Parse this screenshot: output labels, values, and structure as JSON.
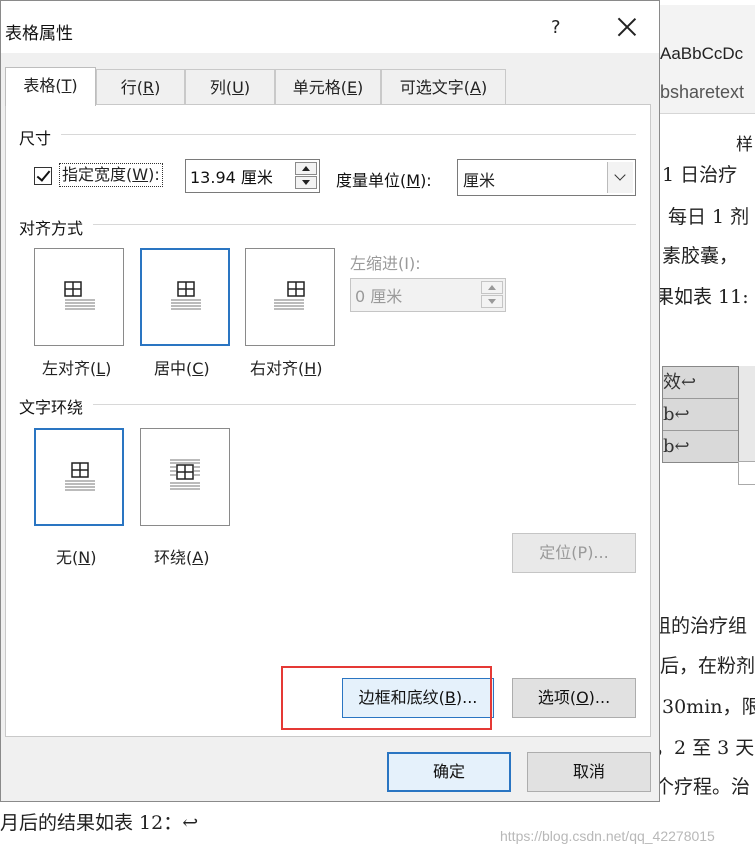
{
  "document": {
    "ribbon_style_preview": "AaBbCcDc",
    "ribbon_style_name": "bsharetext",
    "ribbon_style_label": "样",
    "lines": [
      "1 日治疗",
      "每日 1 剂",
      "素胶囊，",
      "果如表 11:",
      "组的治疗组",
      "后，在粉剂",
      "30min，限",
      "，2 至 3 天",
      "个疗程。治"
    ],
    "table_cells": [
      "效↩",
      "b↩",
      "b↩"
    ],
    "bottom_text": "月后的结果如表 12：↩",
    "watermark": "https://blog.csdn.net/qq_42278015"
  },
  "dialog": {
    "title": "表格属性",
    "help_label": "?",
    "tabs": [
      {
        "label": "表格(",
        "key": "T",
        "tail": ")",
        "active": true
      },
      {
        "label": "行(",
        "key": "R",
        "tail": ")",
        "active": false
      },
      {
        "label": "列(",
        "key": "U",
        "tail": ")",
        "active": false
      },
      {
        "label": "单元格(",
        "key": "E",
        "tail": ")",
        "active": false
      },
      {
        "label": "可选文字(",
        "key": "A",
        "tail": ")",
        "active": false
      }
    ],
    "size_section": {
      "label": "尺寸",
      "checkbox_label_pre": "指定宽度(",
      "checkbox_key": "W",
      "checkbox_label_post": "):",
      "checked": true,
      "width_value": "13.94 厘米",
      "unit_label_pre": "度量单位(",
      "unit_key": "M",
      "unit_label_post": "):",
      "unit_value": "厘米"
    },
    "align_section": {
      "label": "对齐方式",
      "options": [
        {
          "pre": "左对齐(",
          "key": "L",
          "post": ")",
          "selected": false
        },
        {
          "pre": "居中(",
          "key": "C",
          "post": ")",
          "selected": true
        },
        {
          "pre": "右对齐(",
          "key": "H",
          "post": ")",
          "selected": false
        }
      ],
      "indent_label": "左缩进(I):",
      "indent_value": "0 厘米"
    },
    "wrap_section": {
      "label": "文字环绕",
      "options": [
        {
          "pre": "无(",
          "key": "N",
          "post": ")",
          "selected": true
        },
        {
          "pre": "环绕(",
          "key": "A",
          "post": ")",
          "selected": false
        }
      ],
      "position_button": "定位(P)..."
    },
    "borders_button": {
      "pre": "边框和底纹(",
      "key": "B",
      "post": ")..."
    },
    "options_button": {
      "pre": "选项(",
      "key": "O",
      "post": ")..."
    },
    "ok_button": "确定",
    "cancel_button": "取消"
  },
  "colors": {
    "accent": "#2a75c2",
    "highlight_box": "#e53935",
    "dialog_bg": "#f0f0f0"
  }
}
